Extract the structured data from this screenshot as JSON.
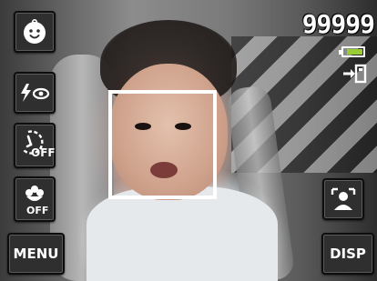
{
  "left_toolbar": {
    "face_detect_icon": "baby-face-icon",
    "flash_icon": "flash-redeye-icon",
    "self_timer_icon": "self-timer-icon",
    "self_timer_state": "OFF",
    "macro_icon": "macro-flower-icon",
    "macro_state": "OFF",
    "menu_label": "MENU"
  },
  "right_toolbar": {
    "face_tracking_icon": "face-tracking-icon",
    "disp_label": "DISP"
  },
  "status": {
    "shots_remaining": "99999",
    "battery_icon": "battery-icon",
    "battery_level": 0.85,
    "storage_icon": "internal-memory-icon"
  },
  "colors": {
    "button_bg": "#2f2f2f",
    "battery_fill": "#9acd32",
    "focus_box": "#ffffff"
  }
}
